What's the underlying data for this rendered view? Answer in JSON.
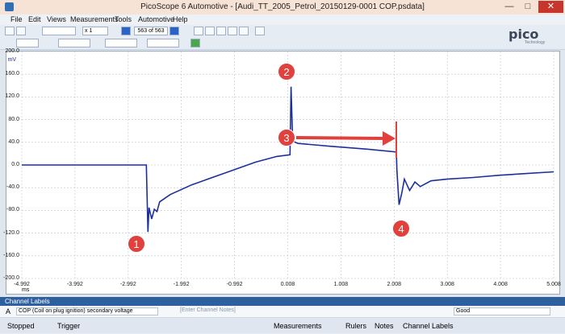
{
  "window": {
    "title": "PicoScope 6 Automotive - [Audi_TT_2005_Petrol_20150129-0001 COP.psdata]",
    "min": "—",
    "max": "□",
    "close": "✕"
  },
  "menu": [
    "File",
    "Edit",
    "Views",
    "Measurements",
    "Tools",
    "Automotive",
    "Help"
  ],
  "toolbar": {
    "zoom": "x 1",
    "buffer": "563 of 563"
  },
  "logo": {
    "name": "pico",
    "sub": "Technology"
  },
  "chart_data": {
    "type": "line",
    "y_unit": "mV",
    "x_unit": "ms",
    "y_ticks": [
      "200.0",
      "160.0",
      "120.0",
      "80.0",
      "40.0",
      "0.0",
      "-40.0",
      "-80.0",
      "-120.0",
      "-160.0",
      "-200.0"
    ],
    "x_ticks": [
      "-4.992",
      "-3.992",
      "-2.992",
      "-1.992",
      "-0.992",
      "0.008",
      "1.008",
      "2.008",
      "3.008",
      "4.008",
      "5.008"
    ],
    "xlim": [
      -4.992,
      5.008
    ],
    "ylim": [
      -200,
      200
    ],
    "grid": true,
    "series": [
      {
        "color": "#1c2f9a",
        "x": [
          -4.992,
          -2.65,
          -2.62,
          -2.6,
          -2.55,
          -2.5,
          -2.45,
          -2.4,
          -2.2,
          -1.8,
          -1.2,
          -0.6,
          -0.2,
          0.05,
          0.07,
          0.1,
          0.2,
          0.8,
          1.5,
          2.05,
          2.06,
          2.1,
          2.15,
          2.2,
          2.3,
          2.4,
          2.5,
          2.7,
          3.0,
          3.5,
          4.0,
          4.5,
          5.008
        ],
        "y": [
          0,
          0,
          -118,
          -75,
          -95,
          -78,
          -82,
          -65,
          -52,
          -35,
          -15,
          5,
          15,
          18,
          138,
          42,
          38,
          33,
          28,
          23,
          -8,
          -70,
          -50,
          -25,
          -45,
          -30,
          -38,
          -28,
          -25,
          -22,
          -18,
          -15,
          -12
        ]
      }
    ],
    "annotations": [
      "1",
      "2",
      "3",
      "4"
    ]
  },
  "channel_labels": {
    "header": "Channel Labels",
    "channel": "A",
    "text": "COP (Coil on plug ignition) secondary voltage",
    "notes_placeholder": "[Enter Channel Notes]",
    "status": "Good"
  },
  "statusbar": {
    "state": "Stopped",
    "trigger": "Trigger",
    "measurements": "Measurements",
    "rulers": "Rulers",
    "notes": "Notes",
    "channel_labels": "Channel Labels"
  }
}
